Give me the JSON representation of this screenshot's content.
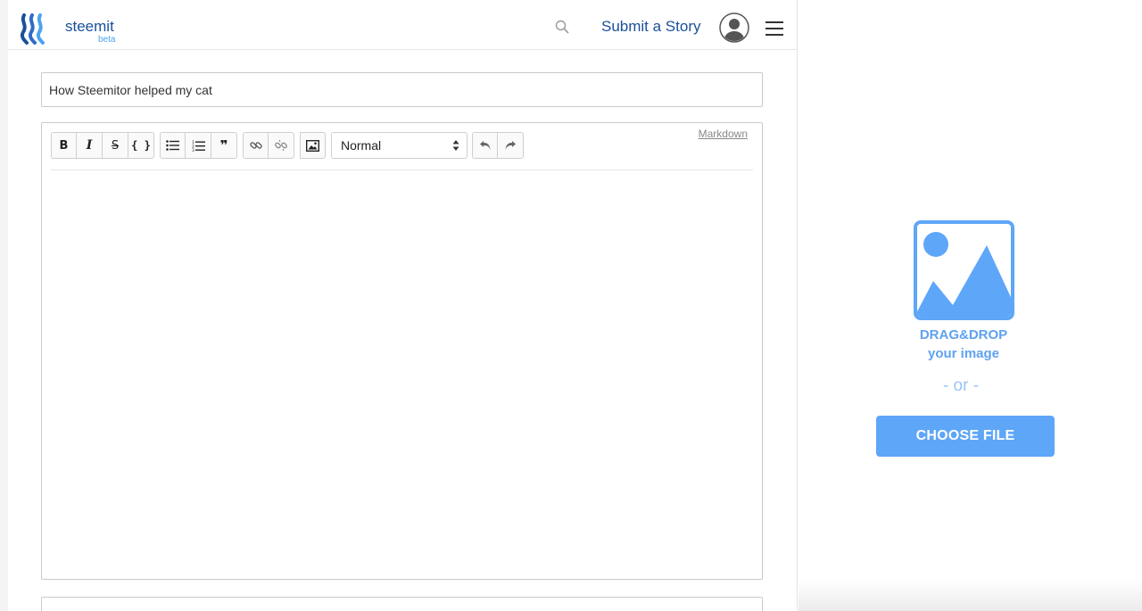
{
  "header": {
    "brand": "steemit",
    "brand_sub": "beta",
    "submit_label": "Submit a Story"
  },
  "post": {
    "title_value": "How Steemitor helped my cat"
  },
  "editor": {
    "markdown_label": "Markdown",
    "format_select_value": "Normal",
    "toolbar_groups": [
      [
        "bold-button",
        "italic-button",
        "strikethrough-button",
        "code-button"
      ],
      [
        "bullet-list-button",
        "numbered-list-button",
        "quote-button"
      ],
      [
        "link-button",
        "unlink-button"
      ],
      [
        "image-button"
      ],
      [
        "undo-button",
        "redo-button"
      ]
    ],
    "toolbar_glyphs": {
      "bold": "B",
      "italic": "I",
      "strike": "S",
      "code": "{ }",
      "quote": "❞"
    }
  },
  "upload": {
    "drop_line1": "DRAG&DROP",
    "drop_line2": "your image",
    "or_text": "- or -",
    "choose_label": "CHOOSE FILE",
    "accent_color": "#5ea6f8"
  },
  "colors": {
    "brand_blue": "#1a5099",
    "light_blue": "#4ba2f2"
  }
}
